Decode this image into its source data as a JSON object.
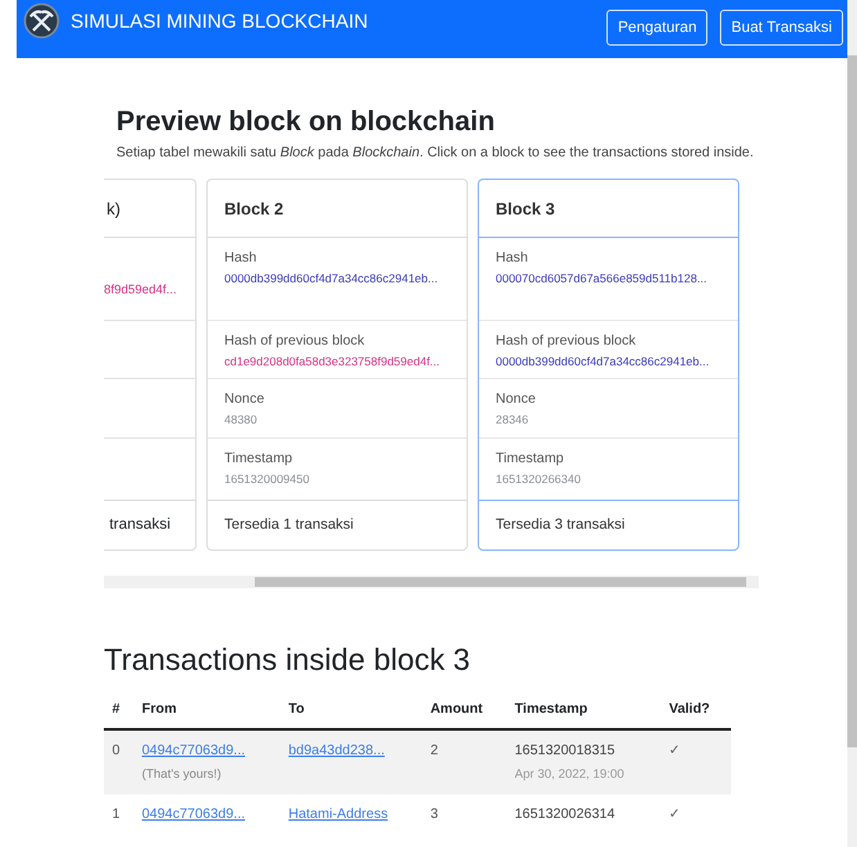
{
  "navbar": {
    "title": "SIMULASI MINING BLOCKCHAIN",
    "buttons": [
      "Pengaturan",
      "Buat Transaksi"
    ]
  },
  "preview": {
    "title": "Preview block on blockchain",
    "description": "Setiap tabel mewakili satu *Block* pada *Blockchain*. Click on a block to see the transactions stored inside."
  },
  "partial_block": {
    "header": "k)",
    "hash": "8f9d59ed4f...",
    "footer": "transaksi"
  },
  "blocks": [
    {
      "title": "Block 2",
      "selected": false,
      "fields": [
        {
          "label": "Hash",
          "value": "0000db399dd60cf4d7a34cc86c2941eb...",
          "kind": "hash"
        },
        {
          "label": "Hash of previous block",
          "value": "cd1e9d208d0fa58d3e323758f9d59ed4f...",
          "kind": "prevhash"
        },
        {
          "label": "Nonce",
          "value": "48380",
          "kind": "plain"
        },
        {
          "label": "Timestamp",
          "value": "1651320009450",
          "kind": "plain"
        }
      ],
      "footer": "Tersedia 1 transaksi"
    },
    {
      "title": "Block 3",
      "selected": true,
      "fields": [
        {
          "label": "Hash",
          "value": "000070cd6057d67a566e859d511b128...",
          "kind": "hash"
        },
        {
          "label": "Hash of previous block",
          "value": "0000db399dd60cf4d7a34cc86c2941eb...",
          "kind": "hash"
        },
        {
          "label": "Nonce",
          "value": "28346",
          "kind": "plain"
        },
        {
          "label": "Timestamp",
          "value": "1651320266340",
          "kind": "plain"
        }
      ],
      "footer": "Tersedia 3 transaksi"
    }
  ],
  "transactions": {
    "title": "Transactions inside block 3",
    "columns": [
      "#",
      "From",
      "To",
      "Amount",
      "Timestamp",
      "Valid?"
    ],
    "rows": [
      {
        "index": "0",
        "from": "0494c77063d9...",
        "from_note": "(That's yours!)",
        "to": "bd9a43dd238...",
        "amount": "2",
        "timestamp": "1651320018315",
        "date": "Apr 30, 2022, 19:00",
        "valid": "✓"
      },
      {
        "index": "1",
        "from": "0494c77063d9...",
        "to": "Hatami-Address",
        "amount": "3",
        "timestamp": "1651320026314",
        "valid": "✓"
      }
    ]
  }
}
